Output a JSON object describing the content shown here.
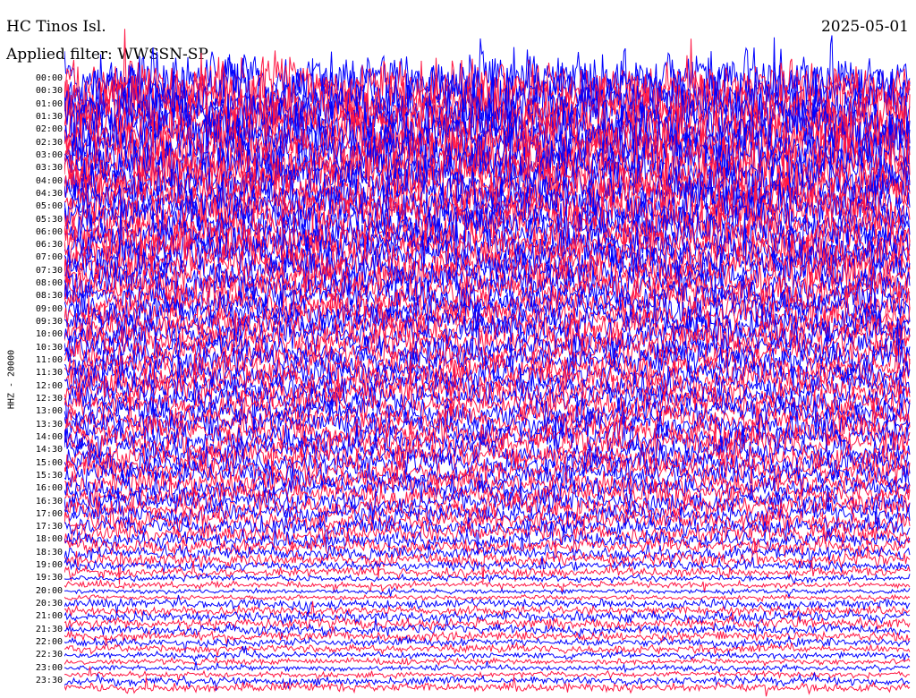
{
  "header": {
    "station": "HC Tinos Isl.",
    "date": "2025-05-01",
    "filter": "Applied filter: WWSSN-SP"
  },
  "chart_data": {
    "type": "helicorder",
    "title": "HC Tinos Isl.",
    "date": "2025-05-01",
    "filter": "WWSSN-SP",
    "channel_label": "HHZ - 20000",
    "line_interval_minutes": 15,
    "row_labels": [
      "00:00",
      "00:30",
      "01:00",
      "01:30",
      "02:00",
      "02:30",
      "03:00",
      "03:30",
      "04:00",
      "04:30",
      "05:00",
      "05:30",
      "06:00",
      "06:30",
      "07:00",
      "07:30",
      "08:00",
      "08:30",
      "09:00",
      "09:30",
      "10:00",
      "10:30",
      "11:00",
      "11:30",
      "12:00",
      "12:30",
      "13:00",
      "13:30",
      "14:00",
      "14:30",
      "15:00",
      "15:30",
      "16:00",
      "16:30",
      "17:00",
      "17:30",
      "18:00",
      "18:30",
      "19:00",
      "19:30",
      "20:00",
      "20:30",
      "21:00",
      "21:30",
      "22:00",
      "22:30",
      "23:00",
      "23:30"
    ],
    "trace_colors": [
      "#0000ff",
      "#ff1744"
    ],
    "amplitude_by_halfhour": [
      3.4,
      3.5,
      3.4,
      3.3,
      3.3,
      3.2,
      3.2,
      3.0,
      2.8,
      2.8,
      2.6,
      2.5,
      2.4,
      2.3,
      2.3,
      2.2,
      2.1,
      2.0,
      2.0,
      1.9,
      1.9,
      1.8,
      1.8,
      1.8,
      1.8,
      1.7,
      1.7,
      1.7,
      1.7,
      1.6,
      1.6,
      1.5,
      1.4,
      1.4,
      1.3,
      1.2,
      1.0,
      0.9,
      0.6,
      0.4,
      0.3,
      0.6,
      0.7,
      0.6,
      0.5,
      0.4,
      0.35,
      0.55
    ]
  }
}
